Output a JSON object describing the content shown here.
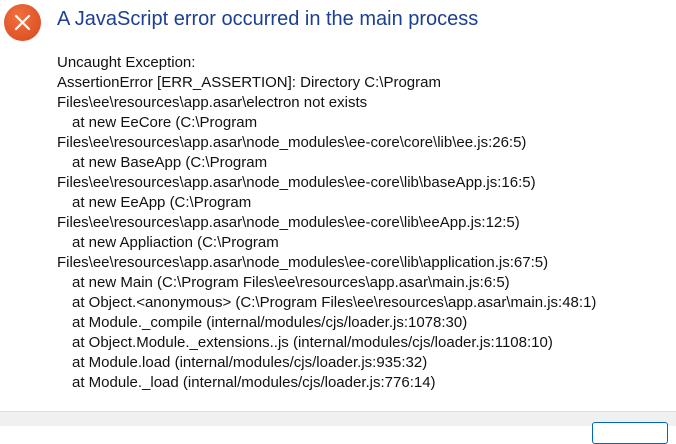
{
  "dialog": {
    "title": "A JavaScript error occurred in the main process",
    "icon": "error-icon",
    "accent_color": "#e0552a",
    "lines": [
      {
        "text": "Uncaught Exception:",
        "indent": false
      },
      {
        "text": "AssertionError [ERR_ASSERTION]: Directory C:\\Program",
        "indent": false
      },
      {
        "text": "Files\\ee\\resources\\app.asar\\electron not exists",
        "indent": false
      },
      {
        "text": "at new EeCore (C:\\Program",
        "indent": true
      },
      {
        "text": "Files\\ee\\resources\\app.asar\\node_modules\\ee-core\\core\\lib\\ee.js:26:5)",
        "indent": false
      },
      {
        "text": "at new BaseApp (C:\\Program",
        "indent": true
      },
      {
        "text": "Files\\ee\\resources\\app.asar\\node_modules\\ee-core\\lib\\baseApp.js:16:5)",
        "indent": false
      },
      {
        "text": "at new EeApp (C:\\Program",
        "indent": true
      },
      {
        "text": "Files\\ee\\resources\\app.asar\\node_modules\\ee-core\\lib\\eeApp.js:12:5)",
        "indent": false
      },
      {
        "text": "at new Appliaction (C:\\Program",
        "indent": true
      },
      {
        "text": "Files\\ee\\resources\\app.asar\\node_modules\\ee-core\\lib\\application.js:67:5)",
        "indent": false
      },
      {
        "text": "at new Main (C:\\Program Files\\ee\\resources\\app.asar\\main.js:6:5)",
        "indent": true
      },
      {
        "text": "at Object.<anonymous> (C:\\Program Files\\ee\\resources\\app.asar\\main.js:48:1)",
        "indent": true
      },
      {
        "text": "at Module._compile (internal/modules/cjs/loader.js:1078:30)",
        "indent": true
      },
      {
        "text": "at Object.Module._extensions..js (internal/modules/cjs/loader.js:1108:10)",
        "indent": true
      },
      {
        "text": "at Module.load (internal/modules/cjs/loader.js:935:32)",
        "indent": true
      },
      {
        "text": "at Module._load (internal/modules/cjs/loader.js:776:14)",
        "indent": true
      }
    ]
  }
}
